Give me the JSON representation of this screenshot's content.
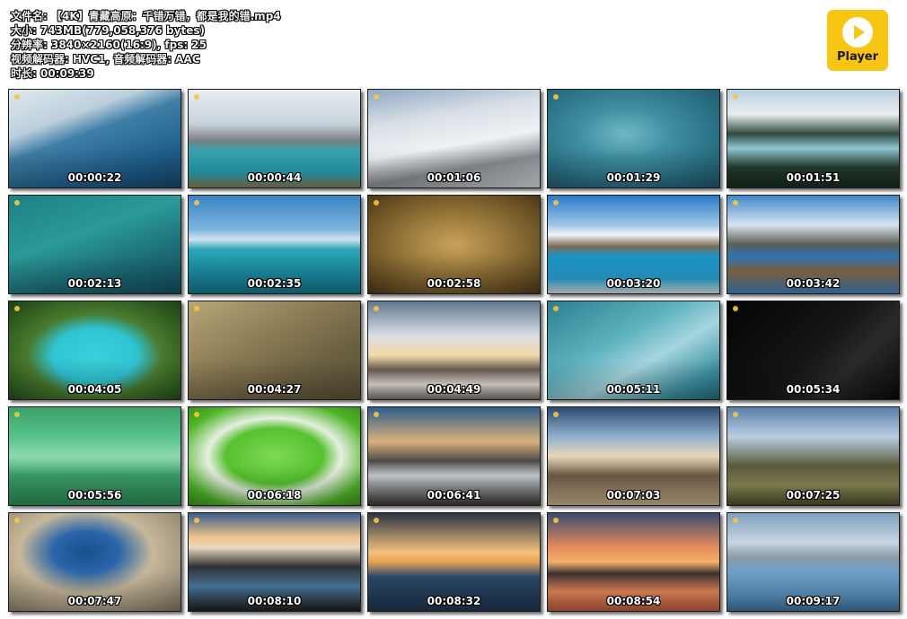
{
  "file_info": {
    "filename": "文件名: 【4K】青藏高原：千错万错，都是我的错.mp4",
    "size": "大小: 743MB(779,058,376 bytes)",
    "resolution": "分辨率: 3840×2160(16:9), fps: 25",
    "codecs": "视频解码器: HVC1, 音频解码器: AAC",
    "duration": "时长: 00:09:39"
  },
  "logo": {
    "label": "Player",
    "color": "#f8c513"
  },
  "thumbnails": [
    {
      "time": "00:00:22",
      "bg": "linear-gradient(160deg,#dfe8ee 0%,#bcd0dc 30%,#3f7ea6 45%,#1f5f8c 75%,#14466b 100%)"
    },
    {
      "time": "00:00:44",
      "bg": "linear-gradient(180deg,#e9eef2 0%,#c7d2da 35%,#7a7f84 52%,#3aa4b0 62%,#26a2b3 85%,#8a7a55 100%)"
    },
    {
      "time": "00:01:06",
      "bg": "linear-gradient(170deg,#8fa9c4 0%,#d9dfe6 30%,#eef2f5 55%,#8b8f94 75%,#d5dade 100%)"
    },
    {
      "time": "00:01:29",
      "bg": "radial-gradient(ellipse at 45% 45%,#6fb8c6 0%,#3e8ea0 35%,#2a6f83 70%,#1e5567 100%)"
    },
    {
      "time": "00:01:51",
      "bg": "linear-gradient(180deg,#b8cfe0 0%,#e9eef2 25%,#2f4a3c 45%,#8fc9d6 60%,#233b2d 80%,#1a2b20 100%)"
    },
    {
      "time": "00:02:13",
      "bg": "linear-gradient(160deg,#1e7f85 0%,#2b9a98 40%,#1c6d78 70%,#12505d 100%)"
    },
    {
      "time": "00:02:35",
      "bg": "linear-gradient(180deg,#3b82c4 0%,#7fb6de 35%,#cfe2ee 45%,#2ea4b8 55%,#1b8ea4 80%,#137689 100%)"
    },
    {
      "time": "00:02:58",
      "bg": "radial-gradient(ellipse at 50% 50%,#c9a25a 0%,#9a7a3c 40%,#6e5426 75%,#4a381a 100%)"
    },
    {
      "time": "00:03:20",
      "bg": "linear-gradient(180deg,#2b78c6 0%,#9cc6e8 30%,#f2f4f5 40%,#7a6a55 52%,#1b95c6 62%,#2aa5d6 85%,#d9dfe2 100%)"
    },
    {
      "time": "00:03:42",
      "bg": "linear-gradient(180deg,#3f86c9 0%,#d7e4ee 30%,#5a5d55 50%,#2f76b5 62%,#8a6a45 78%,#3f80bd 100%)"
    },
    {
      "time": "00:04:05",
      "bg": "radial-gradient(ellipse at 50% 55%,#3ad0db 0%,#2fc4d2 35%,#4a7a2e 55%,#2f5a1f 80%,#1f3f15 100%)"
    },
    {
      "time": "00:04:27",
      "bg": "linear-gradient(150deg,#b8a57a 0%,#8c7c55 40%,#6b6042 70%,#585033 100%)"
    },
    {
      "time": "00:04:49",
      "bg": "linear-gradient(180deg,#5f7890 0%,#d9dfe4 35%,#f4d9a8 55%,#6a5d55 70%,#e9e3dc 85%,#7a6e66 100%)"
    },
    {
      "time": "00:05:11",
      "bg": "linear-gradient(150deg,#2d7f8f 0%,#5fb3c0 40%,#a6d6de 60%,#3a8ea0 85%,#23697a 100%)"
    },
    {
      "time": "00:05:34",
      "bg": "linear-gradient(135deg,#050505 0%,#151515 50%,#2a2a2a 70%,#0a0a0a 100%)"
    },
    {
      "time": "00:05:56",
      "bg": "linear-gradient(180deg,#3aa06a 0%,#59c28a 30%,#8fd9b0 50%,#3aa06a 70%,#2e8a58 100%)"
    },
    {
      "time": "00:06:18",
      "bg": "radial-gradient(ellipse at 50% 50%,#7ed957 0%,#56c22e 40%,#e6efe2 55%,#4fb527 80%,#3a8f1c 100%)"
    },
    {
      "time": "00:06:41",
      "bg": "linear-gradient(180deg,#2f5c8c 0%,#d8b27a 35%,#4c4a48 55%,#c8d0d6 70%,#3a3632 100%)"
    },
    {
      "time": "00:07:03",
      "bg": "linear-gradient(180deg,#2e4b73 0%,#8fb0cf 30%,#e8d6b8 50%,#6e5a46 70%,#c7b08a 100%)"
    },
    {
      "time": "00:07:25",
      "bg": "linear-gradient(180deg,#5a7fa8 0%,#b9cde0 30%,#5c5a3e 60%,#8c8a56 80%,#4a4a2c 100%)"
    },
    {
      "time": "00:07:47",
      "bg": "radial-gradient(ellipse at 45% 40%,#1a4f8c 0%,#2a66a8 25%,#c7b89a 50%,#9c8f78 80%,#7a6f5c 100%)"
    },
    {
      "time": "00:08:10",
      "bg": "linear-gradient(180deg,#3a5f8c 0%,#f0c48a 25%,#e9d9c2 35%,#2f2f2f 55%,#4a7aa0 75%,#1e1e1e 100%)"
    },
    {
      "time": "00:08:32",
      "bg": "linear-gradient(180deg,#2a3344 0%,#f2c27a 40%,#e6a052 50%,#2c4a6a 65%,#1e3550 100%)"
    },
    {
      "time": "00:08:54",
      "bg": "linear-gradient(180deg,#3a4a70 0%,#e58b5a 35%,#f2b06a 50%,#3a3030 62%,#e8895a 80%,#b85a3a 100%)"
    },
    {
      "time": "00:09:17",
      "bg": "linear-gradient(180deg,#7fa0c0 0%,#c9d6e2 30%,#8a9aa8 45%,#6fa2c9 60%,#5a92bd 85%,#3f6f99 100%)"
    }
  ]
}
